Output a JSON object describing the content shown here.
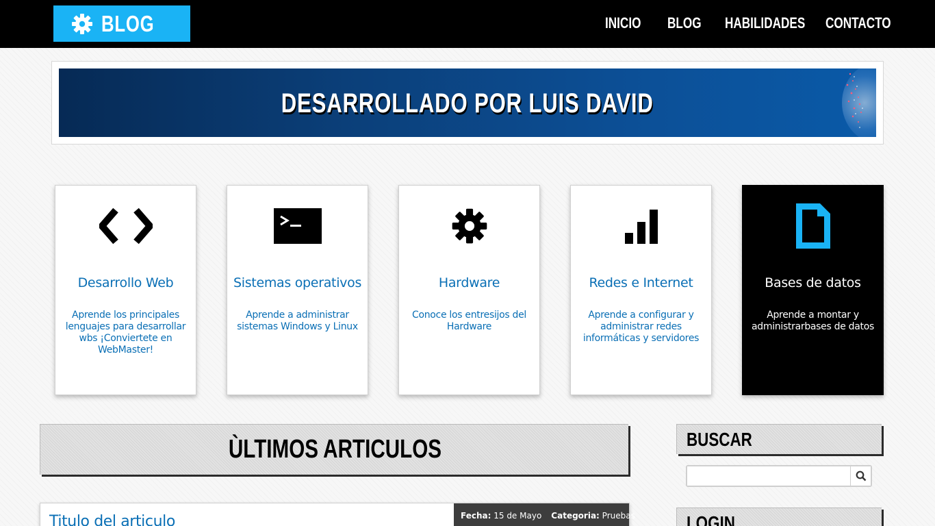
{
  "navbar": {
    "brand": "BLOG",
    "items": [
      {
        "label": "INICIO"
      },
      {
        "label": "BLOG"
      },
      {
        "label": "HABILIDADES"
      },
      {
        "label": "CONTACTO"
      }
    ]
  },
  "banner": {
    "title": "DESARROLLADO POR LUIS DAVID"
  },
  "cards": [
    {
      "icon": "code-icon",
      "title": "Desarrollo Web",
      "description": "Aprende los principales lenguajes para desarrollar wbs ¡Conviertete en WebMaster!"
    },
    {
      "icon": "terminal-icon",
      "title": "Sistemas operativos",
      "description": "Aprende a administrar sistemas Windows y Linux"
    },
    {
      "icon": "gear-icon",
      "title": "Hardware",
      "description": "Conoce los entresijos del Hardware"
    },
    {
      "icon": "signal-bars-icon",
      "title": "Redes e Internet",
      "description": "Aprende a configurar y administrar redes informáticas y servidores"
    },
    {
      "icon": "document-icon",
      "title": "Bases de datos",
      "description": "Aprende a montar y administrarbases de datos"
    }
  ],
  "latest": {
    "heading": "ÙLTIMOS ARTICULOS"
  },
  "sidebar": {
    "search_heading": "BUSCAR",
    "search_placeholder": "",
    "login_heading": "LOGIN"
  },
  "article": {
    "title": "Titulo del articulo",
    "date_label": "Fecha:",
    "date_value": "15 de Mayo",
    "category_label": "Categoria:",
    "category_value": "Pruebas"
  },
  "colors": {
    "accent": "#1ab3f5",
    "link": "#0a6fb5",
    "navbar": "#000000"
  }
}
